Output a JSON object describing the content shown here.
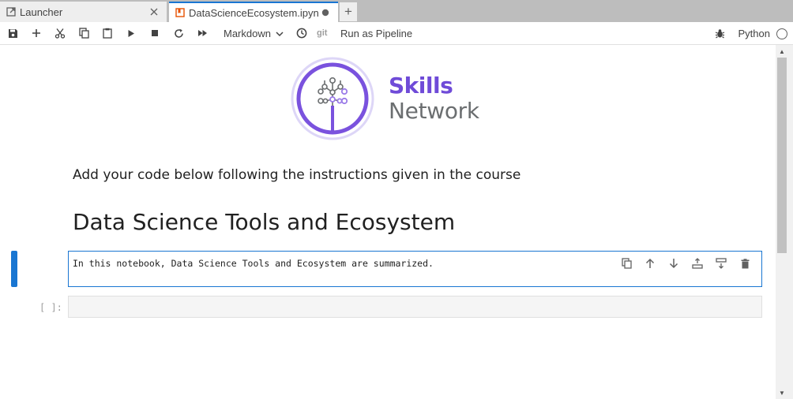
{
  "tabs": [
    {
      "label": "Launcher",
      "icon": "launcher-icon",
      "close": "×"
    },
    {
      "label": "DataScienceEcosystem.ipyn",
      "icon": "notebook-icon",
      "status": "unsaved-dot-icon"
    }
  ],
  "add_tab": "+",
  "toolbar": {
    "cell_type": "Markdown",
    "git_label": "git",
    "pipeline_label": "Run as Pipeline",
    "kernel_name": "Python"
  },
  "logo": {
    "line1": "Skills",
    "line2": "Network"
  },
  "notebook": {
    "instruction": "Add your code below following the instructions given in the course",
    "heading": "Data Science Tools and Ecosystem",
    "active_cell_text": "In this notebook, Data Science Tools and Ecosystem are summarized.",
    "code_prompt": "[ ]:"
  },
  "colors": {
    "accent": "#1976d2",
    "brand_purple": "#6f4bd8",
    "brand_gray": "#6b6e70"
  }
}
